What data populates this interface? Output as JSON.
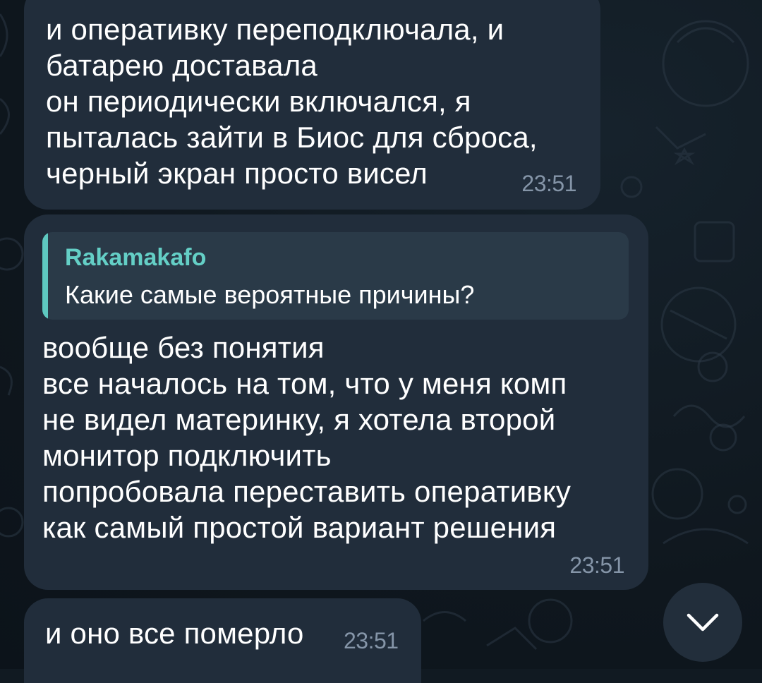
{
  "messages": [
    {
      "text": "и оперативку переподключала, и\nбатарею доставала\nон периодически включался, я\nпыталась зайти в Биос для сброса,\nчерный экран просто висел",
      "time": "23:51"
    },
    {
      "reply": {
        "author": "Rakamakafo",
        "text": "Какие самые вероятные причины?"
      },
      "text": "вообще без понятия\nвсе началось на том, что у меня комп\nне видел материнку, я хотела второй\nмонитор подключить\nпопробовала переставить оперативку\nкак самый простой вариант решения",
      "time": "23:51"
    },
    {
      "text": "и оно все померло",
      "time": "23:51"
    }
  ],
  "controls": {
    "scroll_down_icon": "chevron-down-icon"
  },
  "colors": {
    "background": "#111a22",
    "bubble": "#212d3b",
    "reply_accent": "#5ec8c0",
    "timestamp": "#8595a8"
  }
}
